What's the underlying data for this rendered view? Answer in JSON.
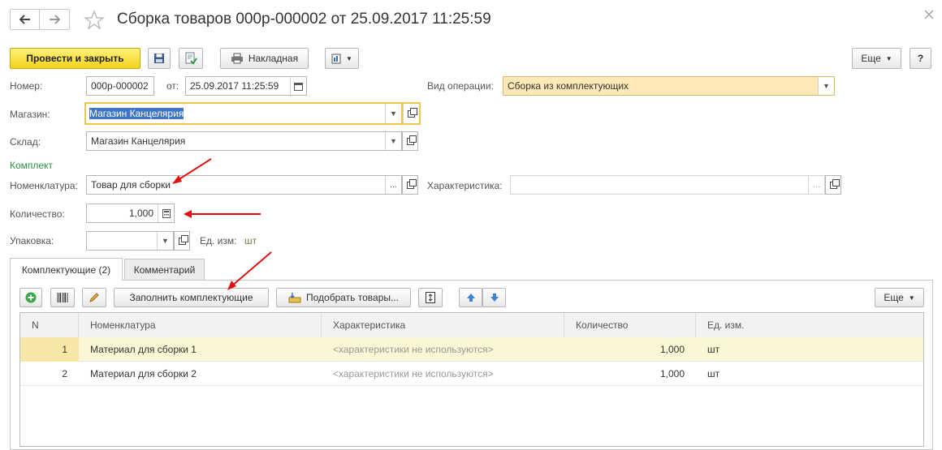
{
  "window": {
    "title": "Сборка товаров 000р-000002 от 25.09.2017 11:25:59"
  },
  "toolbar": {
    "post_and_close": "Провести и закрыть",
    "invoice": "Накладная",
    "more": "Еще",
    "help": "?"
  },
  "form": {
    "number_label": "Номер:",
    "number_value": "000р-000002",
    "date_label": "от:",
    "date_value": "25.09.2017 11:25:59",
    "operation_label": "Вид операции:",
    "operation_value": "Сборка из комплектующих",
    "shop_label": "Магазин:",
    "shop_value": "Магазин Канцелярия",
    "warehouse_label": "Склад:",
    "warehouse_value": "Магазин Канцелярия",
    "kit_section": "Комплект",
    "nomenclature_label": "Номенклатура:",
    "nomenclature_value": "Товар для сборки",
    "characteristic_label": "Характеристика:",
    "characteristic_value": "",
    "quantity_label": "Количество:",
    "quantity_value": "1,000",
    "package_label": "Упаковка:",
    "package_value": "",
    "unit_label": "Ед. изм:",
    "unit_value": "шт"
  },
  "tabs": [
    {
      "label": "Комплектующие (2)",
      "active": true
    },
    {
      "label": "Комментарий",
      "active": false
    }
  ],
  "table_toolbar": {
    "fill": "Заполнить комплектующие",
    "pick": "Подобрать товары...",
    "more": "Еще"
  },
  "table": {
    "columns": [
      "N",
      "Номенклатура",
      "Характеристика",
      "Количество",
      "Ед. изм."
    ],
    "rows": [
      {
        "n": "1",
        "item": "Материал для сборки 1",
        "characteristic": "<характеристики не используются>",
        "qty": "1,000",
        "unit": "шт",
        "selected": true
      },
      {
        "n": "2",
        "item": "Материал для сборки 2",
        "characteristic": "<характеристики не используются>",
        "qty": "1,000",
        "unit": "шт",
        "selected": false
      }
    ]
  },
  "colors": {
    "accent_yellow": "#f2d21c",
    "selected_row": "#fbf6d3",
    "selected_text_bg": "#3f74c6",
    "operation_bg": "#fde8b8",
    "section_green": "#2f8f3f",
    "annotation_red": "#e01010"
  }
}
